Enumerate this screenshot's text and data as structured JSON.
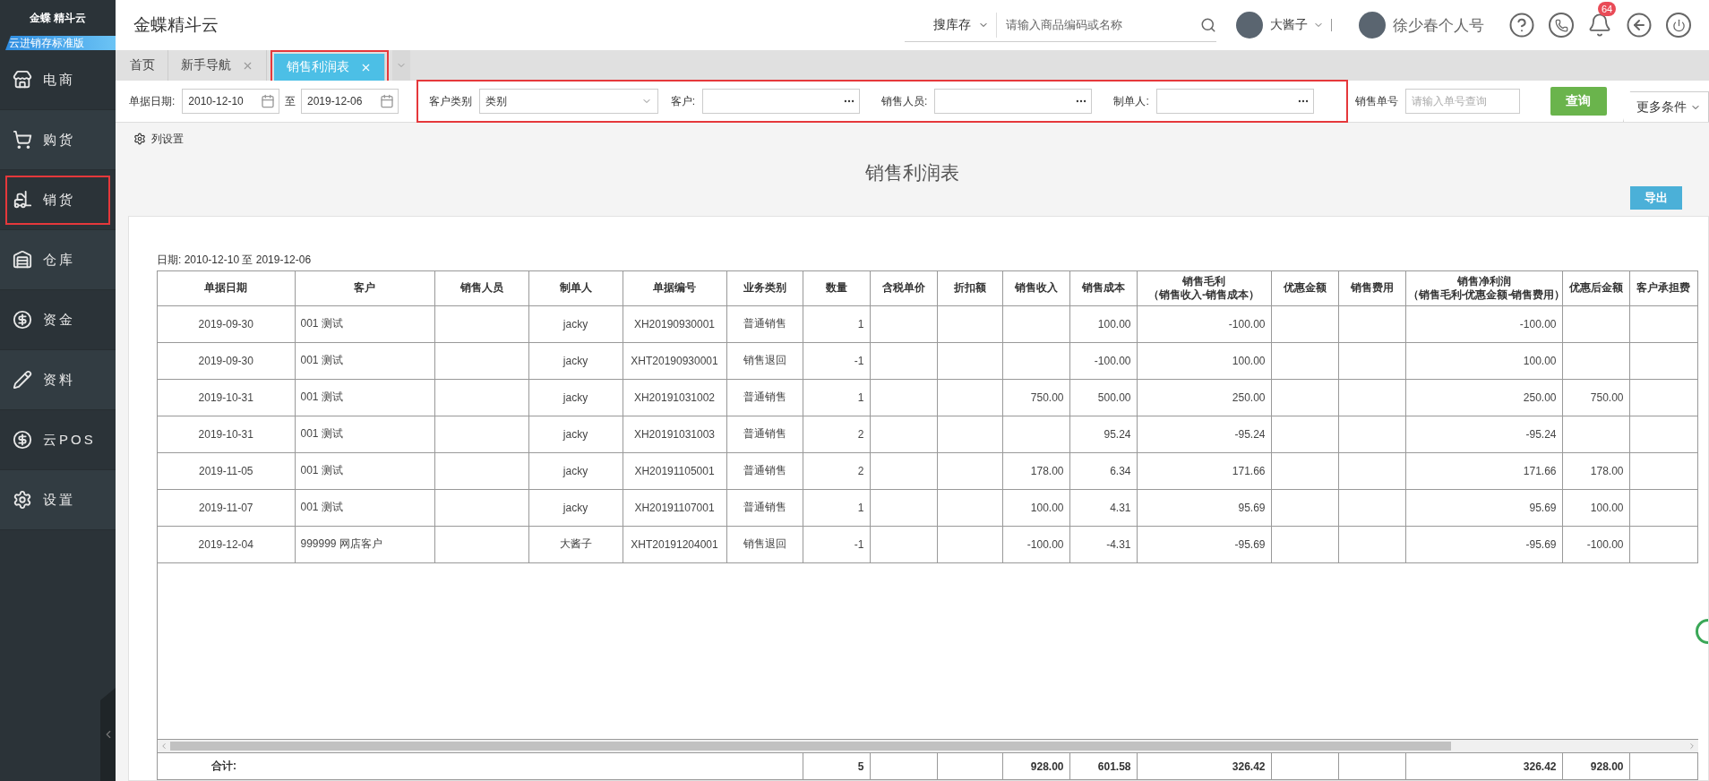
{
  "sidebar": {
    "logo": "金蝶 精斗云",
    "edition": "云进销存标准版",
    "items": [
      {
        "label": "电商",
        "highlighted": false
      },
      {
        "label": "购货",
        "highlighted": false
      },
      {
        "label": "销货",
        "highlighted": true
      },
      {
        "label": "仓库",
        "highlighted": false
      },
      {
        "label": "资金",
        "highlighted": false
      },
      {
        "label": "资料",
        "highlighted": false
      },
      {
        "label": "云POS",
        "highlighted": false
      },
      {
        "label": "设置",
        "highlighted": false
      }
    ]
  },
  "header": {
    "brand": "金蝶精斗云",
    "search_scope": "搜库存",
    "search_placeholder": "请输入商品编码或名称",
    "store": "大酱子",
    "user": "徐少春个人号",
    "notifications": "64"
  },
  "tabs": [
    {
      "label": "首页",
      "selected": false,
      "closable": false,
      "highlighted": false
    },
    {
      "label": "新手导航",
      "selected": false,
      "closable": true,
      "highlighted": false
    },
    {
      "label": "销售利润表",
      "selected": true,
      "closable": true,
      "highlighted": true
    }
  ],
  "filters": {
    "date_label": "单据日期:",
    "date_from": "2010-12-10",
    "date_sep": "至",
    "date_to": "2019-12-06",
    "highlighted": true,
    "customer_type_label": "客户类别",
    "customer_type_value": "类别",
    "lookups": [
      {
        "label": "客户:"
      },
      {
        "label": "销售人员:"
      },
      {
        "label": "制单人:"
      }
    ],
    "order_label": "销售单号",
    "order_placeholder": "请输入单号查询",
    "query_button": "查询",
    "more": "更多条件"
  },
  "column_settings": "列设置",
  "report": {
    "title": "销售利润表",
    "export_button": "导出",
    "date_range": "日期: 2010-12-10 至 2019-12-06",
    "columns": [
      {
        "label": "单据日期"
      },
      {
        "label": "客户"
      },
      {
        "label": "销售人员"
      },
      {
        "label": "制单人"
      },
      {
        "label": "单据编号"
      },
      {
        "label": "业务类别"
      },
      {
        "label": "数量"
      },
      {
        "label": "含税单价"
      },
      {
        "label": "折扣额"
      },
      {
        "label": "销售收入"
      },
      {
        "label": "销售成本"
      },
      {
        "label": "销售毛利",
        "sub": "（销售收入-销售成本）"
      },
      {
        "label": "优惠金额"
      },
      {
        "label": "销售费用"
      },
      {
        "label": "销售净利润",
        "sub": "（销售毛利-优惠金额-销售费用）"
      },
      {
        "label": "优惠后金额"
      },
      {
        "label": "客户承担费"
      }
    ],
    "rows": [
      [
        "2019-09-30",
        "001 测试",
        null,
        "jacky",
        "XH20190930001",
        "普通销售",
        "1",
        null,
        null,
        null,
        "100.00",
        "-100.00",
        null,
        null,
        "-100.00",
        null,
        null
      ],
      [
        "2019-09-30",
        "001 测试",
        null,
        "jacky",
        "XHT20190930001",
        "销售退回",
        "-1",
        null,
        null,
        null,
        "-100.00",
        "100.00",
        null,
        null,
        "100.00",
        null,
        null
      ],
      [
        "2019-10-31",
        "001 测试",
        null,
        "jacky",
        "XH20191031002",
        "普通销售",
        "1",
        null,
        null,
        "750.00",
        "500.00",
        "250.00",
        null,
        null,
        "250.00",
        "750.00",
        null
      ],
      [
        "2019-10-31",
        "001 测试",
        null,
        "jacky",
        "XH20191031003",
        "普通销售",
        "2",
        null,
        null,
        null,
        "95.24",
        "-95.24",
        null,
        null,
        "-95.24",
        null,
        null
      ],
      [
        "2019-11-05",
        "001 测试",
        null,
        "jacky",
        "XH20191105001",
        "普通销售",
        "2",
        null,
        null,
        "178.00",
        "6.34",
        "171.66",
        null,
        null,
        "171.66",
        "178.00",
        null
      ],
      [
        "2019-11-07",
        "001 测试",
        null,
        "jacky",
        "XH20191107001",
        "普通销售",
        "1",
        null,
        null,
        "100.00",
        "4.31",
        "95.69",
        null,
        null,
        "95.69",
        "100.00",
        null
      ],
      [
        "2019-12-04",
        "999999 网店客户",
        null,
        "大酱子",
        "XHT20191204001",
        "销售退回",
        "-1",
        null,
        null,
        "-100.00",
        "-4.31",
        "-95.69",
        null,
        null,
        "-95.69",
        "-100.00",
        null
      ]
    ],
    "totals": {
      "label": "合计:",
      "cells": [
        "5",
        null,
        null,
        "928.00",
        "601.58",
        "326.42",
        null,
        null,
        "326.42",
        "928.00",
        null
      ]
    }
  }
}
